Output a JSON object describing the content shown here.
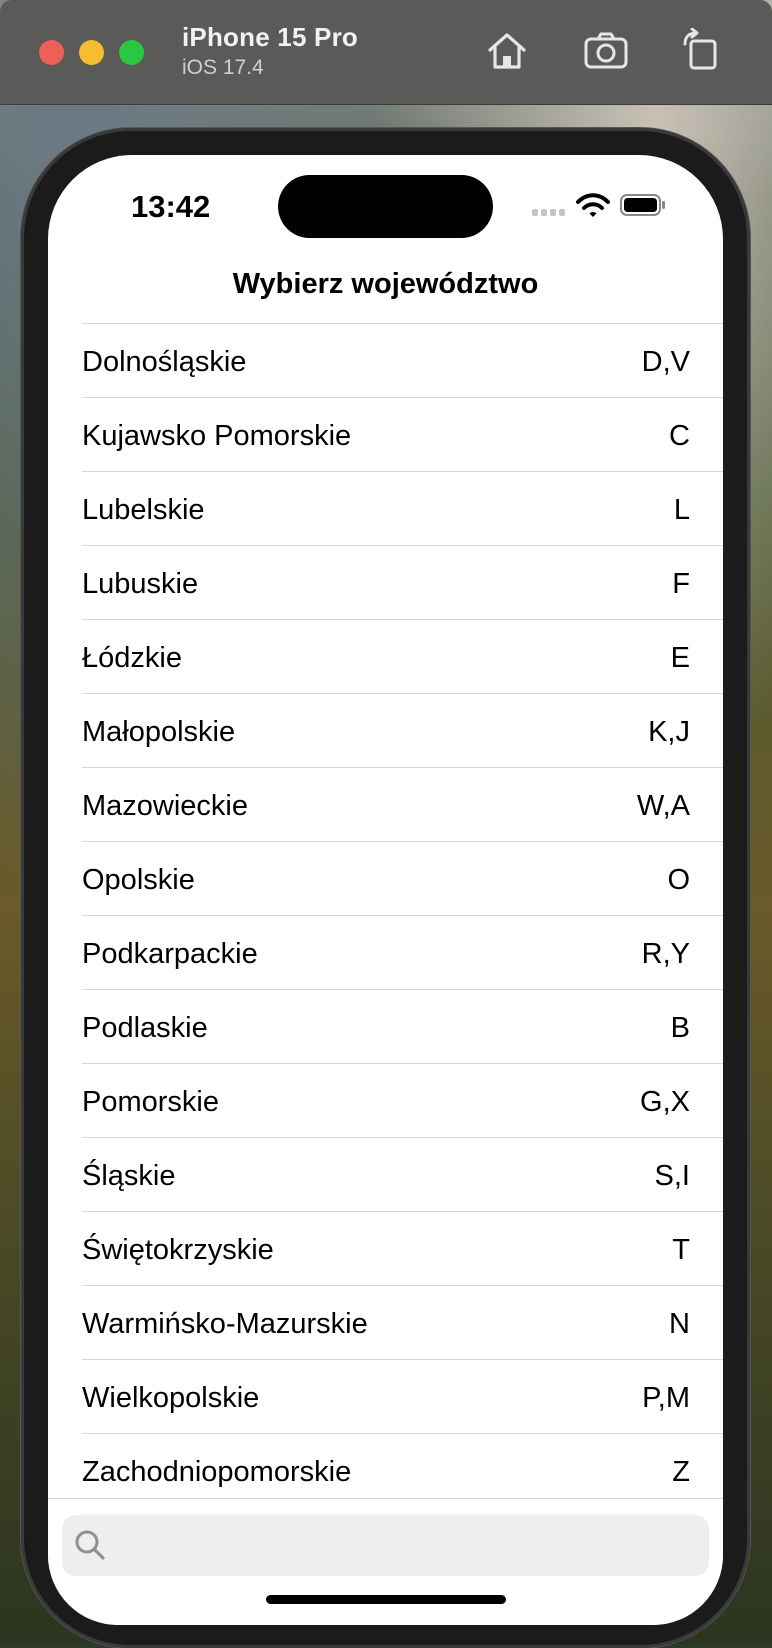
{
  "simulator": {
    "device_name": "iPhone 15 Pro",
    "os_version": "iOS 17.4",
    "buttons": [
      "home-icon",
      "screenshot-icon",
      "rotate-icon"
    ]
  },
  "status_bar": {
    "time": "13:42",
    "icons": [
      "cellular-signal-icon",
      "wifi-icon",
      "battery-icon"
    ]
  },
  "nav": {
    "title": "Wybierz województwo"
  },
  "list": {
    "rows": [
      {
        "name": "Dolnośląskie",
        "code": "D,V"
      },
      {
        "name": "Kujawsko Pomorskie",
        "code": "C"
      },
      {
        "name": "Lubelskie",
        "code": "L"
      },
      {
        "name": "Lubuskie",
        "code": "F"
      },
      {
        "name": "Łódzkie",
        "code": "E"
      },
      {
        "name": "Małopolskie",
        "code": "K,J"
      },
      {
        "name": "Mazowieckie",
        "code": "W,A"
      },
      {
        "name": "Opolskie",
        "code": "O"
      },
      {
        "name": "Podkarpackie",
        "code": "R,Y"
      },
      {
        "name": "Podlaskie",
        "code": "B"
      },
      {
        "name": "Pomorskie",
        "code": "G,X"
      },
      {
        "name": "Śląskie",
        "code": "S,I"
      },
      {
        "name": "Świętokrzyskie",
        "code": "T"
      },
      {
        "name": "Warmińsko-Mazurskie",
        "code": "N"
      },
      {
        "name": "Wielkopolskie",
        "code": "P,M"
      },
      {
        "name": "Zachodniopomorskie",
        "code": "Z"
      }
    ]
  },
  "search": {
    "value": "",
    "placeholder": "",
    "icon": "search-icon"
  }
}
